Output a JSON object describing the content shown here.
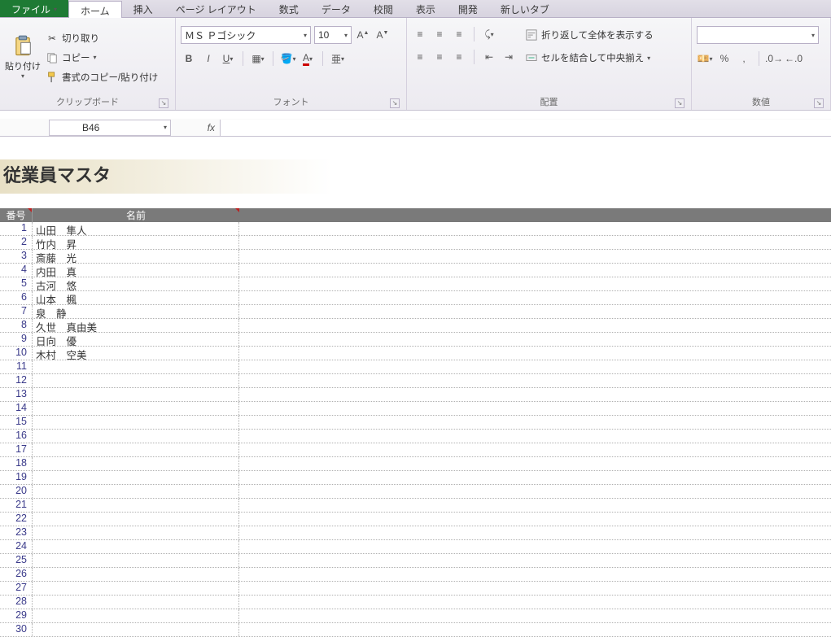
{
  "tabs": {
    "file": "ファイル",
    "home": "ホーム",
    "insert": "挿入",
    "pagelayout": "ページ レイアウト",
    "formulas": "数式",
    "data": "データ",
    "review": "校閲",
    "view": "表示",
    "developer": "開発",
    "newtab": "新しいタブ"
  },
  "ribbon": {
    "clipboard": {
      "paste": "貼り付け",
      "cut": "切り取り",
      "copy": "コピー",
      "formatpainter": "書式のコピー/貼り付け",
      "label": "クリップボード"
    },
    "font": {
      "fontname": "ＭＳ Ｐゴシック",
      "fontsize": "10",
      "label": "フォント"
    },
    "alignment": {
      "wrap": "折り返して全体を表示する",
      "merge": "セルを結合して中央揃え",
      "label": "配置"
    },
    "number": {
      "label": "数値",
      "percent": "%",
      "comma": ","
    }
  },
  "formula_bar": {
    "namebox": "B46",
    "fx": "fx",
    "value": ""
  },
  "sheet": {
    "title": "従業員マスタ",
    "headers": {
      "c1": "番号",
      "c2": "名前"
    },
    "records": [
      {
        "n": "1",
        "name": "山田　隼人"
      },
      {
        "n": "2",
        "name": "竹内　昇"
      },
      {
        "n": "3",
        "name": "斎藤　光"
      },
      {
        "n": "4",
        "name": "内田　真"
      },
      {
        "n": "5",
        "name": "古河　悠"
      },
      {
        "n": "6",
        "name": "山本　楓"
      },
      {
        "n": "7",
        "name": "泉　静"
      },
      {
        "n": "8",
        "name": "久世　真由美"
      },
      {
        "n": "9",
        "name": "日向　優"
      },
      {
        "n": "10",
        "name": "木村　空美"
      },
      {
        "n": "11",
        "name": ""
      },
      {
        "n": "12",
        "name": ""
      },
      {
        "n": "13",
        "name": ""
      },
      {
        "n": "14",
        "name": ""
      },
      {
        "n": "15",
        "name": ""
      },
      {
        "n": "16",
        "name": ""
      },
      {
        "n": "17",
        "name": ""
      },
      {
        "n": "18",
        "name": ""
      },
      {
        "n": "19",
        "name": ""
      },
      {
        "n": "20",
        "name": ""
      },
      {
        "n": "21",
        "name": ""
      },
      {
        "n": "22",
        "name": ""
      },
      {
        "n": "23",
        "name": ""
      },
      {
        "n": "24",
        "name": ""
      },
      {
        "n": "25",
        "name": ""
      },
      {
        "n": "26",
        "name": ""
      },
      {
        "n": "27",
        "name": ""
      },
      {
        "n": "28",
        "name": ""
      },
      {
        "n": "29",
        "name": ""
      },
      {
        "n": "30",
        "name": ""
      }
    ]
  }
}
